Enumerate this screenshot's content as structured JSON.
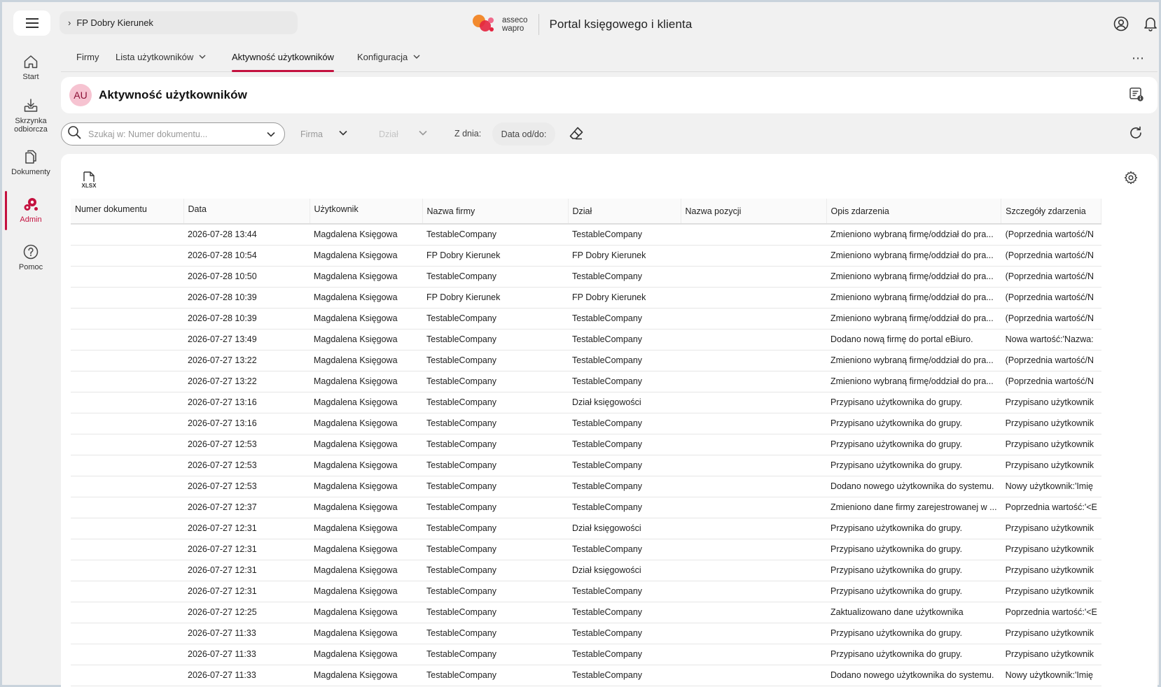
{
  "header": {
    "breadcrumb": "FP Dobry Kierunek",
    "brand_line1": "asseco",
    "brand_line2": "wapro",
    "portal_title": "Portal księgowego i klienta"
  },
  "sidebar": {
    "items": [
      {
        "label": "Start",
        "icon": "home-icon"
      },
      {
        "label_l1": "Skrzynka",
        "label_l2": "odbiorcza",
        "icon": "inbox-icon"
      },
      {
        "label": "Dokumenty",
        "icon": "documents-icon"
      },
      {
        "label": "Admin",
        "icon": "admin-icon",
        "active": true
      },
      {
        "label": "Pomoc",
        "icon": "help-icon"
      }
    ]
  },
  "tabs": [
    {
      "label": "Firmy"
    },
    {
      "label": "Lista użytkowników"
    },
    {
      "label": "Aktywność użytkowników",
      "active": true
    },
    {
      "label": "Konfiguracja"
    }
  ],
  "page": {
    "avatar": "AU",
    "title": "Aktywność użytkowników"
  },
  "filters": {
    "search_placeholder": "Szukaj w: Numer dokumentu...",
    "firma": "Firma",
    "dzial": "Dział",
    "z_dnia": "Z dnia:",
    "data_od_do": "Data od/do:"
  },
  "grid": {
    "xlsx_label": "XLSX",
    "columns": [
      "Numer dokumentu",
      "Data",
      "Użytkownik",
      "Nazwa firmy",
      "Dział",
      "Nazwa pozycji",
      "Opis zdarzenia",
      "Szczegóły zdarzenia"
    ],
    "rows": [
      [
        "",
        "2026-07-28 13:44",
        "Magdalena Księgowa",
        "TestableCompany",
        "TestableCompany",
        "",
        "Zmieniono wybraną firmę/oddział do pra...",
        "(Poprzednia wartość/N"
      ],
      [
        "",
        "2026-07-28 10:54",
        "Magdalena Księgowa",
        "FP Dobry Kierunek",
        "FP Dobry Kierunek",
        "",
        "Zmieniono wybraną firmę/oddział do pra...",
        "(Poprzednia wartość/N"
      ],
      [
        "",
        "2026-07-28 10:50",
        "Magdalena Księgowa",
        "TestableCompany",
        "TestableCompany",
        "",
        "Zmieniono wybraną firmę/oddział do pra...",
        "(Poprzednia wartość/N"
      ],
      [
        "",
        "2026-07-28 10:39",
        "Magdalena Księgowa",
        "FP Dobry Kierunek",
        "FP Dobry Kierunek",
        "",
        "Zmieniono wybraną firmę/oddział do pra...",
        "(Poprzednia wartość/N"
      ],
      [
        "",
        "2026-07-28 10:39",
        "Magdalena Księgowa",
        "TestableCompany",
        "TestableCompany",
        "",
        "Zmieniono wybraną firmę/oddział do pra...",
        "(Poprzednia wartość/N"
      ],
      [
        "",
        "2026-07-27 13:49",
        "Magdalena Księgowa",
        "TestableCompany",
        "TestableCompany",
        "",
        "Dodano nową firmę do portal eBiuro.",
        "Nowa wartość:'Nazwa:"
      ],
      [
        "",
        "2026-07-27 13:22",
        "Magdalena Księgowa",
        "TestableCompany",
        "TestableCompany",
        "",
        "Zmieniono wybraną firmę/oddział do pra...",
        "(Poprzednia wartość/N"
      ],
      [
        "",
        "2026-07-27 13:22",
        "Magdalena Księgowa",
        "TestableCompany",
        "TestableCompany",
        "",
        "Zmieniono wybraną firmę/oddział do pra...",
        "(Poprzednia wartość/N"
      ],
      [
        "",
        "2026-07-27 13:16",
        "Magdalena Księgowa",
        "TestableCompany",
        "Dział księgowości",
        "",
        "Przypisano użytkownika do grupy.",
        "Przypisano użytkownik"
      ],
      [
        "",
        "2026-07-27 13:16",
        "Magdalena Księgowa",
        "TestableCompany",
        "TestableCompany",
        "",
        "Przypisano użytkownika do grupy.",
        "Przypisano użytkownik"
      ],
      [
        "",
        "2026-07-27 12:53",
        "Magdalena Księgowa",
        "TestableCompany",
        "TestableCompany",
        "",
        "Przypisano użytkownika do grupy.",
        "Przypisano użytkownik"
      ],
      [
        "",
        "2026-07-27 12:53",
        "Magdalena Księgowa",
        "TestableCompany",
        "TestableCompany",
        "",
        "Przypisano użytkownika do grupy.",
        "Przypisano użytkownik"
      ],
      [
        "",
        "2026-07-27 12:53",
        "Magdalena Księgowa",
        "TestableCompany",
        "TestableCompany",
        "",
        "Dodano nowego użytkownika do systemu.",
        "Nowy użytkownik:'Imię"
      ],
      [
        "",
        "2026-07-27 12:37",
        "Magdalena Księgowa",
        "TestableCompany",
        "TestableCompany",
        "",
        "Zmieniono dane firmy zarejestrowanej w ...",
        "Poprzednia wartość:'<E"
      ],
      [
        "",
        "2026-07-27 12:31",
        "Magdalena Księgowa",
        "TestableCompany",
        "Dział księgowości",
        "",
        "Przypisano użytkownika do grupy.",
        "Przypisano użytkownik"
      ],
      [
        "",
        "2026-07-27 12:31",
        "Magdalena Księgowa",
        "TestableCompany",
        "TestableCompany",
        "",
        "Przypisano użytkownika do grupy.",
        "Przypisano użytkownik"
      ],
      [
        "",
        "2026-07-27 12:31",
        "Magdalena Księgowa",
        "TestableCompany",
        "Dział księgowości",
        "",
        "Przypisano użytkownika do grupy.",
        "Przypisano użytkownik"
      ],
      [
        "",
        "2026-07-27 12:31",
        "Magdalena Księgowa",
        "TestableCompany",
        "TestableCompany",
        "",
        "Przypisano użytkownika do grupy.",
        "Przypisano użytkownik"
      ],
      [
        "",
        "2026-07-27 12:25",
        "Magdalena Księgowa",
        "TestableCompany",
        "TestableCompany",
        "",
        "Zaktualizowano dane użytkownika",
        "Poprzednia wartość:'<E"
      ],
      [
        "",
        "2026-07-27 11:33",
        "Magdalena Księgowa",
        "TestableCompany",
        "TestableCompany",
        "",
        "Przypisano użytkownika do grupy.",
        "Przypisano użytkownik"
      ],
      [
        "",
        "2026-07-27 11:33",
        "Magdalena Księgowa",
        "TestableCompany",
        "TestableCompany",
        "",
        "Przypisano użytkownika do grupy.",
        "Przypisano użytkownik"
      ],
      [
        "",
        "2026-07-27 11:33",
        "Magdalena Księgowa",
        "TestableCompany",
        "TestableCompany",
        "",
        "Dodano nowego użytkownika do systemu.",
        "Nowy użytkownik:'Imię"
      ]
    ]
  },
  "colors": {
    "accent": "#c4113f",
    "avatar_bg": "#f6c3d1",
    "logo_orange": "#f28a2e",
    "logo_red": "#e4233f",
    "logo_pink": "#f06a8b"
  }
}
